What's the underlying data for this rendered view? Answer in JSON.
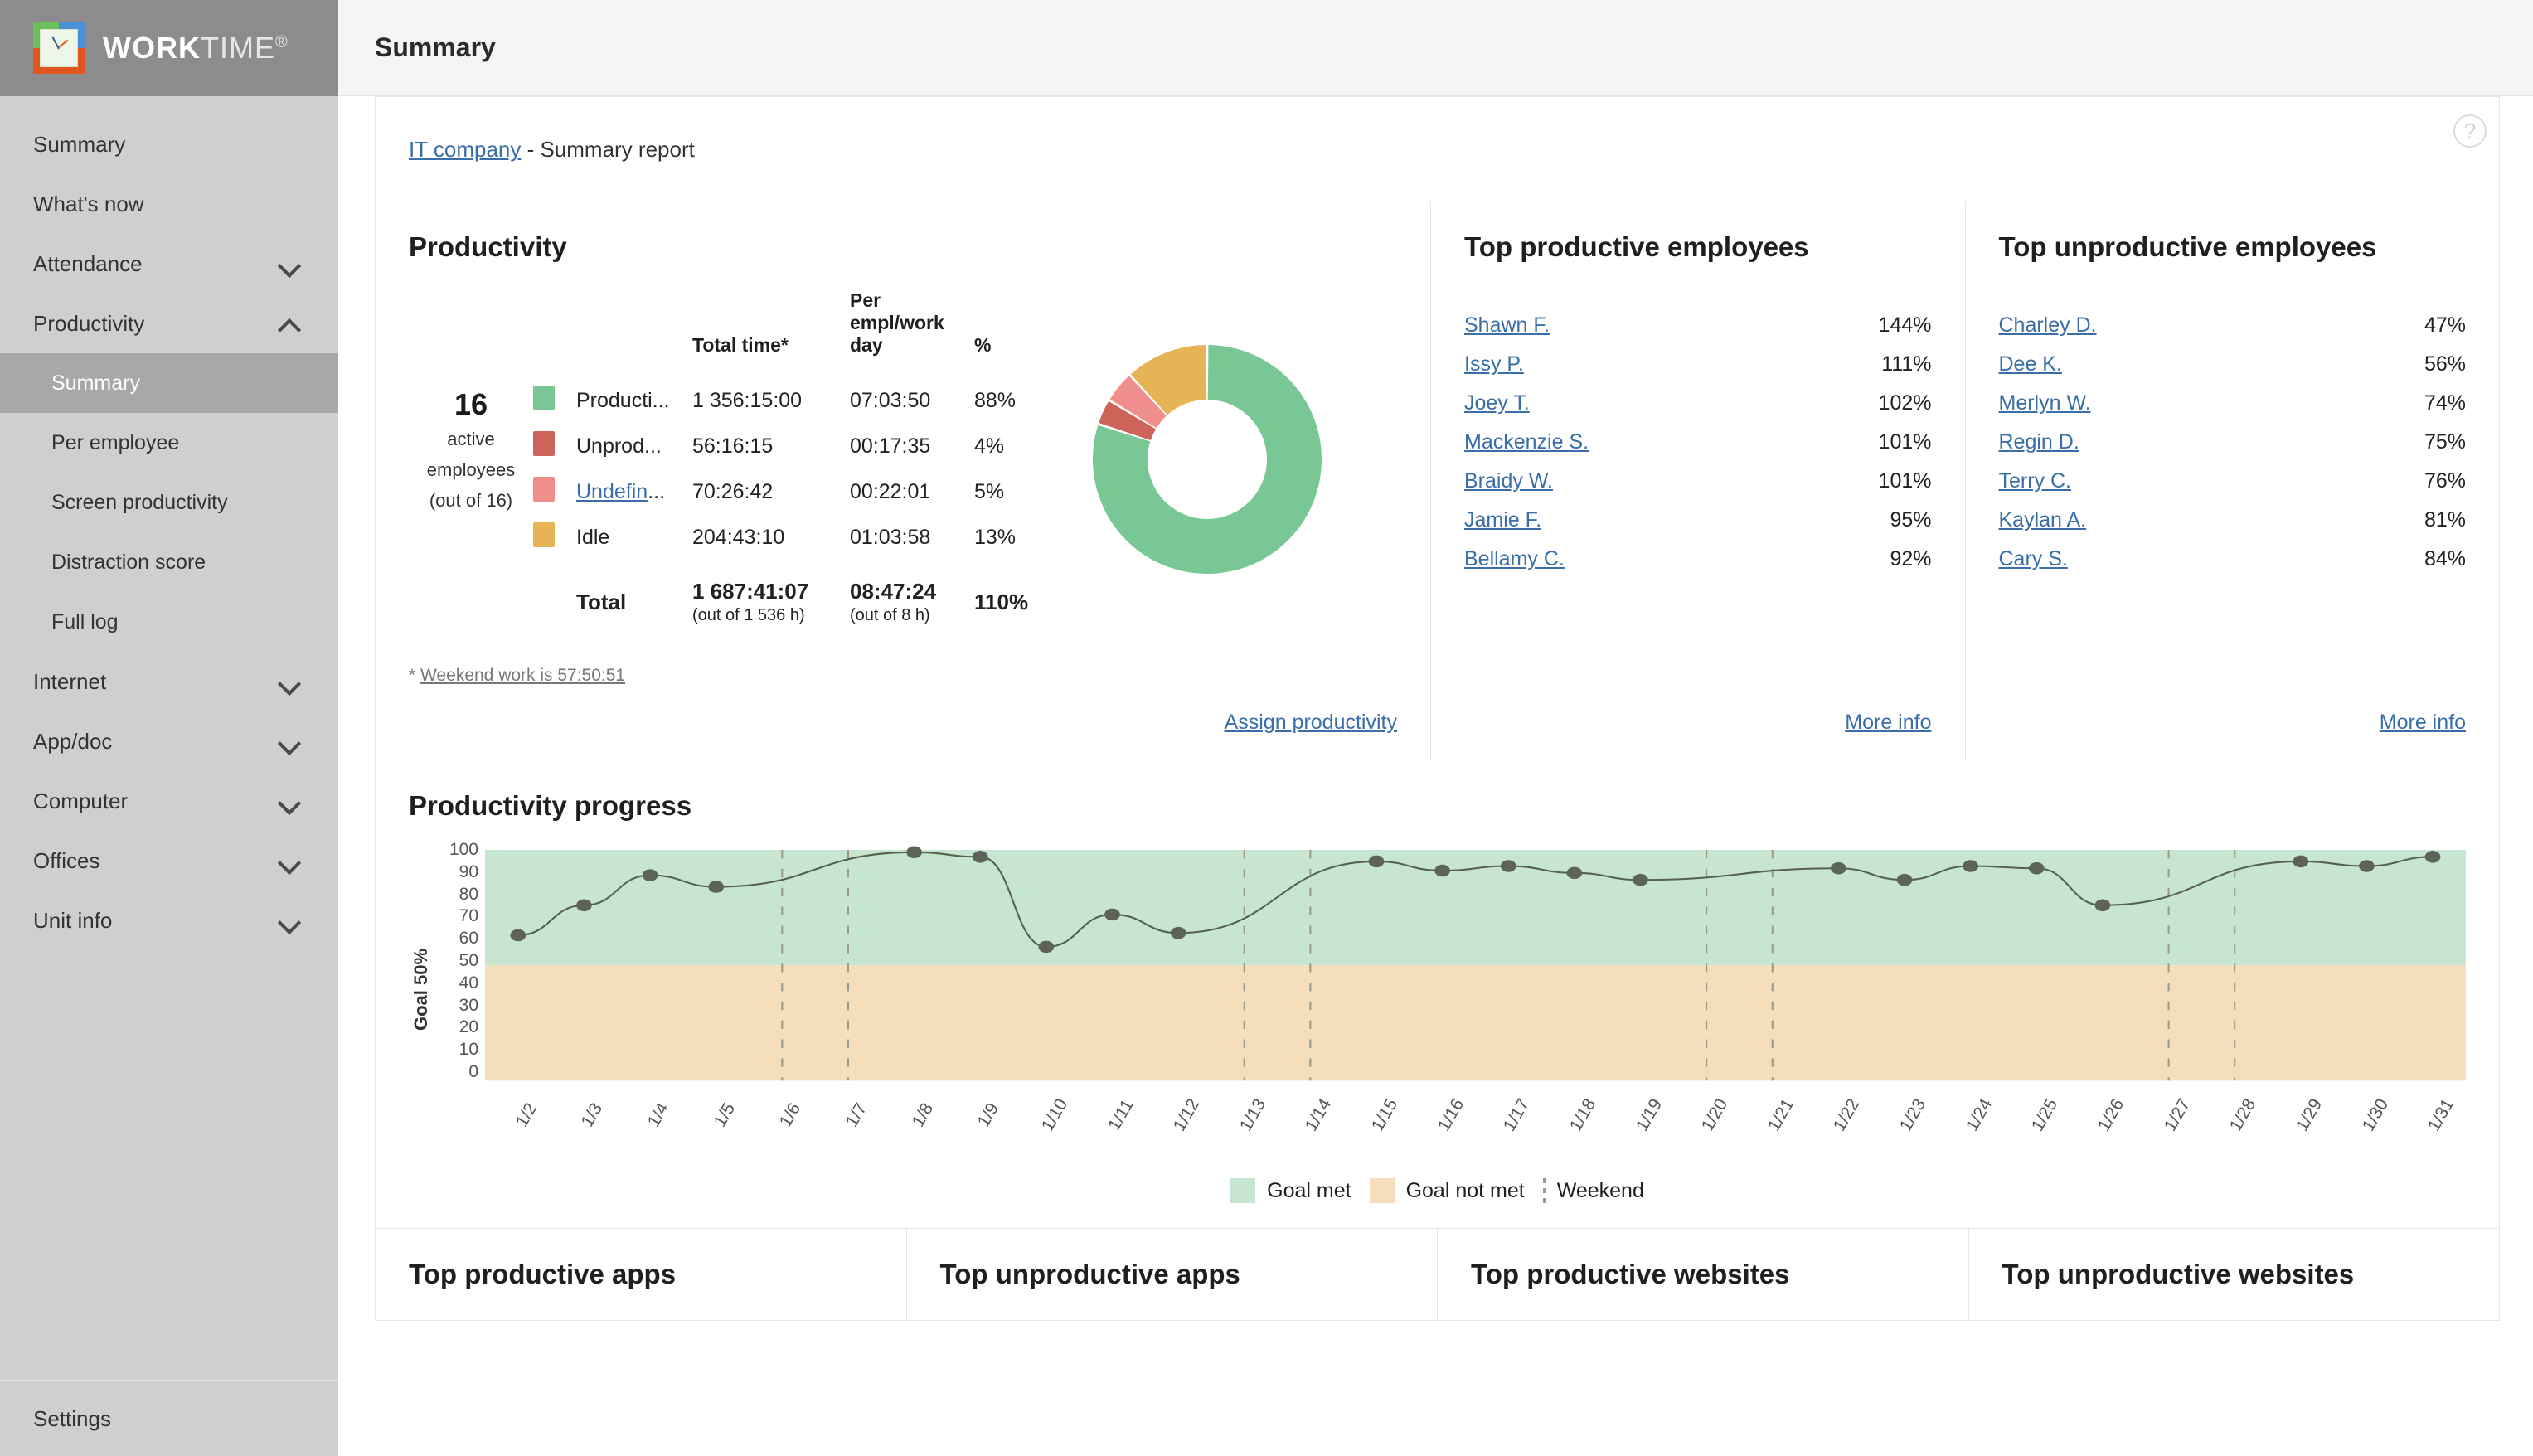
{
  "brand": {
    "name_bold": "WORK",
    "name_light": "TIME",
    "registered": "®",
    "logo_icon": "clock-logo-icon"
  },
  "sidebar": {
    "items": [
      {
        "label": "Summary",
        "type": "link",
        "level": 0,
        "active": false
      },
      {
        "label": "What's now",
        "type": "link",
        "level": 0,
        "active": false
      },
      {
        "label": "Attendance",
        "type": "group",
        "level": 0,
        "chevron": "down",
        "active": false
      },
      {
        "label": "Productivity",
        "type": "group",
        "level": 0,
        "chevron": "up",
        "active": false
      },
      {
        "label": "Summary",
        "type": "link",
        "level": 1,
        "active": true
      },
      {
        "label": "Per employee",
        "type": "link",
        "level": 1,
        "active": false
      },
      {
        "label": "Screen productivity",
        "type": "link",
        "level": 1,
        "active": false
      },
      {
        "label": "Distraction score",
        "type": "link",
        "level": 1,
        "active": false
      },
      {
        "label": "Full log",
        "type": "link",
        "level": 1,
        "active": false
      },
      {
        "label": "Internet",
        "type": "group",
        "level": 0,
        "chevron": "down",
        "active": false
      },
      {
        "label": "App/doc",
        "type": "group",
        "level": 0,
        "chevron": "down",
        "active": false
      },
      {
        "label": "Computer",
        "type": "group",
        "level": 0,
        "chevron": "down",
        "active": false
      },
      {
        "label": "Offices",
        "type": "group",
        "level": 0,
        "chevron": "down",
        "active": false
      },
      {
        "label": "Unit info",
        "type": "group",
        "level": 0,
        "chevron": "down",
        "active": false
      }
    ],
    "footer_label": "Settings"
  },
  "topbar": {
    "title": "Summary",
    "help_icon": "help-question-icon",
    "help_glyph": "?"
  },
  "breadcrumb": {
    "company_link": "IT company",
    "suffix": " - Summary report"
  },
  "productivity": {
    "title": "Productivity",
    "active_count": "16",
    "active_label_line1": "active",
    "active_label_line2": "employees",
    "active_label_line3": "(out of 16)",
    "columns": [
      "Total time*",
      "Per empl/work day",
      "%"
    ],
    "rows": [
      {
        "color": "#7ac796",
        "name": "Producti...",
        "full_name": "Productive",
        "total": "1 356:15:00",
        "per_day": "07:03:50",
        "pct": "88%",
        "is_link": false
      },
      {
        "color": "#cc6459",
        "name": "Unprod...",
        "full_name": "Unproductive",
        "total": "56:16:15",
        "per_day": "00:17:35",
        "pct": "4%",
        "is_link": false
      },
      {
        "color": "#ef8e8b",
        "name": "Undefin...",
        "full_name": "Undefined",
        "total": "70:26:42",
        "per_day": "00:22:01",
        "pct": "5%",
        "is_link": true
      },
      {
        "color": "#e5b košt",
        "name": "Idle",
        "full_name": "Idle",
        "total": "204:43:10",
        "per_day": "01:03:58",
        "pct": "13%",
        "is_link": false
      }
    ],
    "total_label": "Total",
    "total_time": "1 687:41:07",
    "total_time_note": "(out of 1 536 h)",
    "total_per_day": "08:47:24",
    "total_per_day_note": "(out of 8 h)",
    "total_pct": "110%",
    "weekend_note_prefix": "* ",
    "weekend_note": "Weekend work is 57:50:51",
    "assign_link": "Assign productivity"
  },
  "chart_data": [
    {
      "type": "pie",
      "title": "Productivity",
      "labels": [
        "Productive",
        "Unproductive",
        "Undefined",
        "Idle"
      ],
      "values": [
        88,
        4,
        5,
        13
      ],
      "colors": [
        "#7ac796",
        "#cc6459",
        "#ef8e8b",
        "#e5b457"
      ],
      "donut": true,
      "legend": "left-table"
    },
    {
      "type": "line",
      "title": "Productivity progress",
      "ylabel": "Goal 50%",
      "xlabel": "",
      "ylim": [
        0,
        100
      ],
      "yticks": [
        0,
        10,
        20,
        30,
        40,
        50,
        60,
        70,
        80,
        90,
        100
      ],
      "goal": 50,
      "grid": false,
      "x": [
        "1/2",
        "1/3",
        "1/4",
        "1/5",
        "1/6",
        "1/7",
        "1/8",
        "1/9",
        "1/10",
        "1/11",
        "1/12",
        "1/13",
        "1/14",
        "1/15",
        "1/16",
        "1/17",
        "1/18",
        "1/19",
        "1/20",
        "1/21",
        "1/22",
        "1/23",
        "1/24",
        "1/25",
        "1/26",
        "1/27",
        "1/28",
        "1/29",
        "1/30",
        "1/31"
      ],
      "values": [
        63,
        76,
        89,
        84,
        null,
        null,
        99,
        97,
        58,
        72,
        64,
        null,
        null,
        95,
        91,
        93,
        90,
        87,
        null,
        null,
        92,
        87,
        93,
        92,
        76,
        null,
        null,
        95,
        93,
        97
      ],
      "weekends": [
        "1/6",
        "1/7",
        "1/13",
        "1/14",
        "1/20",
        "1/21",
        "1/27",
        "1/28"
      ],
      "legend": [
        {
          "label": "Goal met",
          "color": "#c6e6d1",
          "marker": "square"
        },
        {
          "label": "Goal not met",
          "color": "#f5debc",
          "marker": "square"
        },
        {
          "label": "Weekend",
          "color": "#9a9a8a",
          "marker": "dashed-line"
        }
      ],
      "band_goal_met_color": "#c6e6d1",
      "band_goal_not_met_color": "#f5debc",
      "line_color": "#55604f",
      "marker_color": "#5d6359"
    }
  ],
  "top_productive": {
    "title": "Top productive employees",
    "rows": [
      {
        "name": "Shawn F.",
        "pct": "144%"
      },
      {
        "name": "Issy P.",
        "pct": "111%"
      },
      {
        "name": "Joey T.",
        "pct": "102%"
      },
      {
        "name": "Mackenzie S.",
        "pct": "101%"
      },
      {
        "name": "Braidy W.",
        "pct": "101%"
      },
      {
        "name": "Jamie F.",
        "pct": "95%"
      },
      {
        "name": "Bellamy C.",
        "pct": "92%"
      }
    ],
    "more_link": "More info"
  },
  "top_unproductive": {
    "title": "Top unproductive employees",
    "rows": [
      {
        "name": "Charley D.",
        "pct": "47%"
      },
      {
        "name": "Dee K.",
        "pct": "56%"
      },
      {
        "name": "Merlyn W.",
        "pct": "74%"
      },
      {
        "name": "Regin D.",
        "pct": "75%"
      },
      {
        "name": "Terry C.",
        "pct": "76%"
      },
      {
        "name": "Kaylan A.",
        "pct": "81%"
      },
      {
        "name": "Cary S.",
        "pct": "84%"
      }
    ],
    "more_link": "More info"
  },
  "progress": {
    "title": "Productivity progress"
  },
  "bottom_cards": [
    {
      "title": "Top productive apps"
    },
    {
      "title": "Top unproductive apps"
    },
    {
      "title": "Top productive websites"
    },
    {
      "title": "Top unproductive websites"
    }
  ]
}
